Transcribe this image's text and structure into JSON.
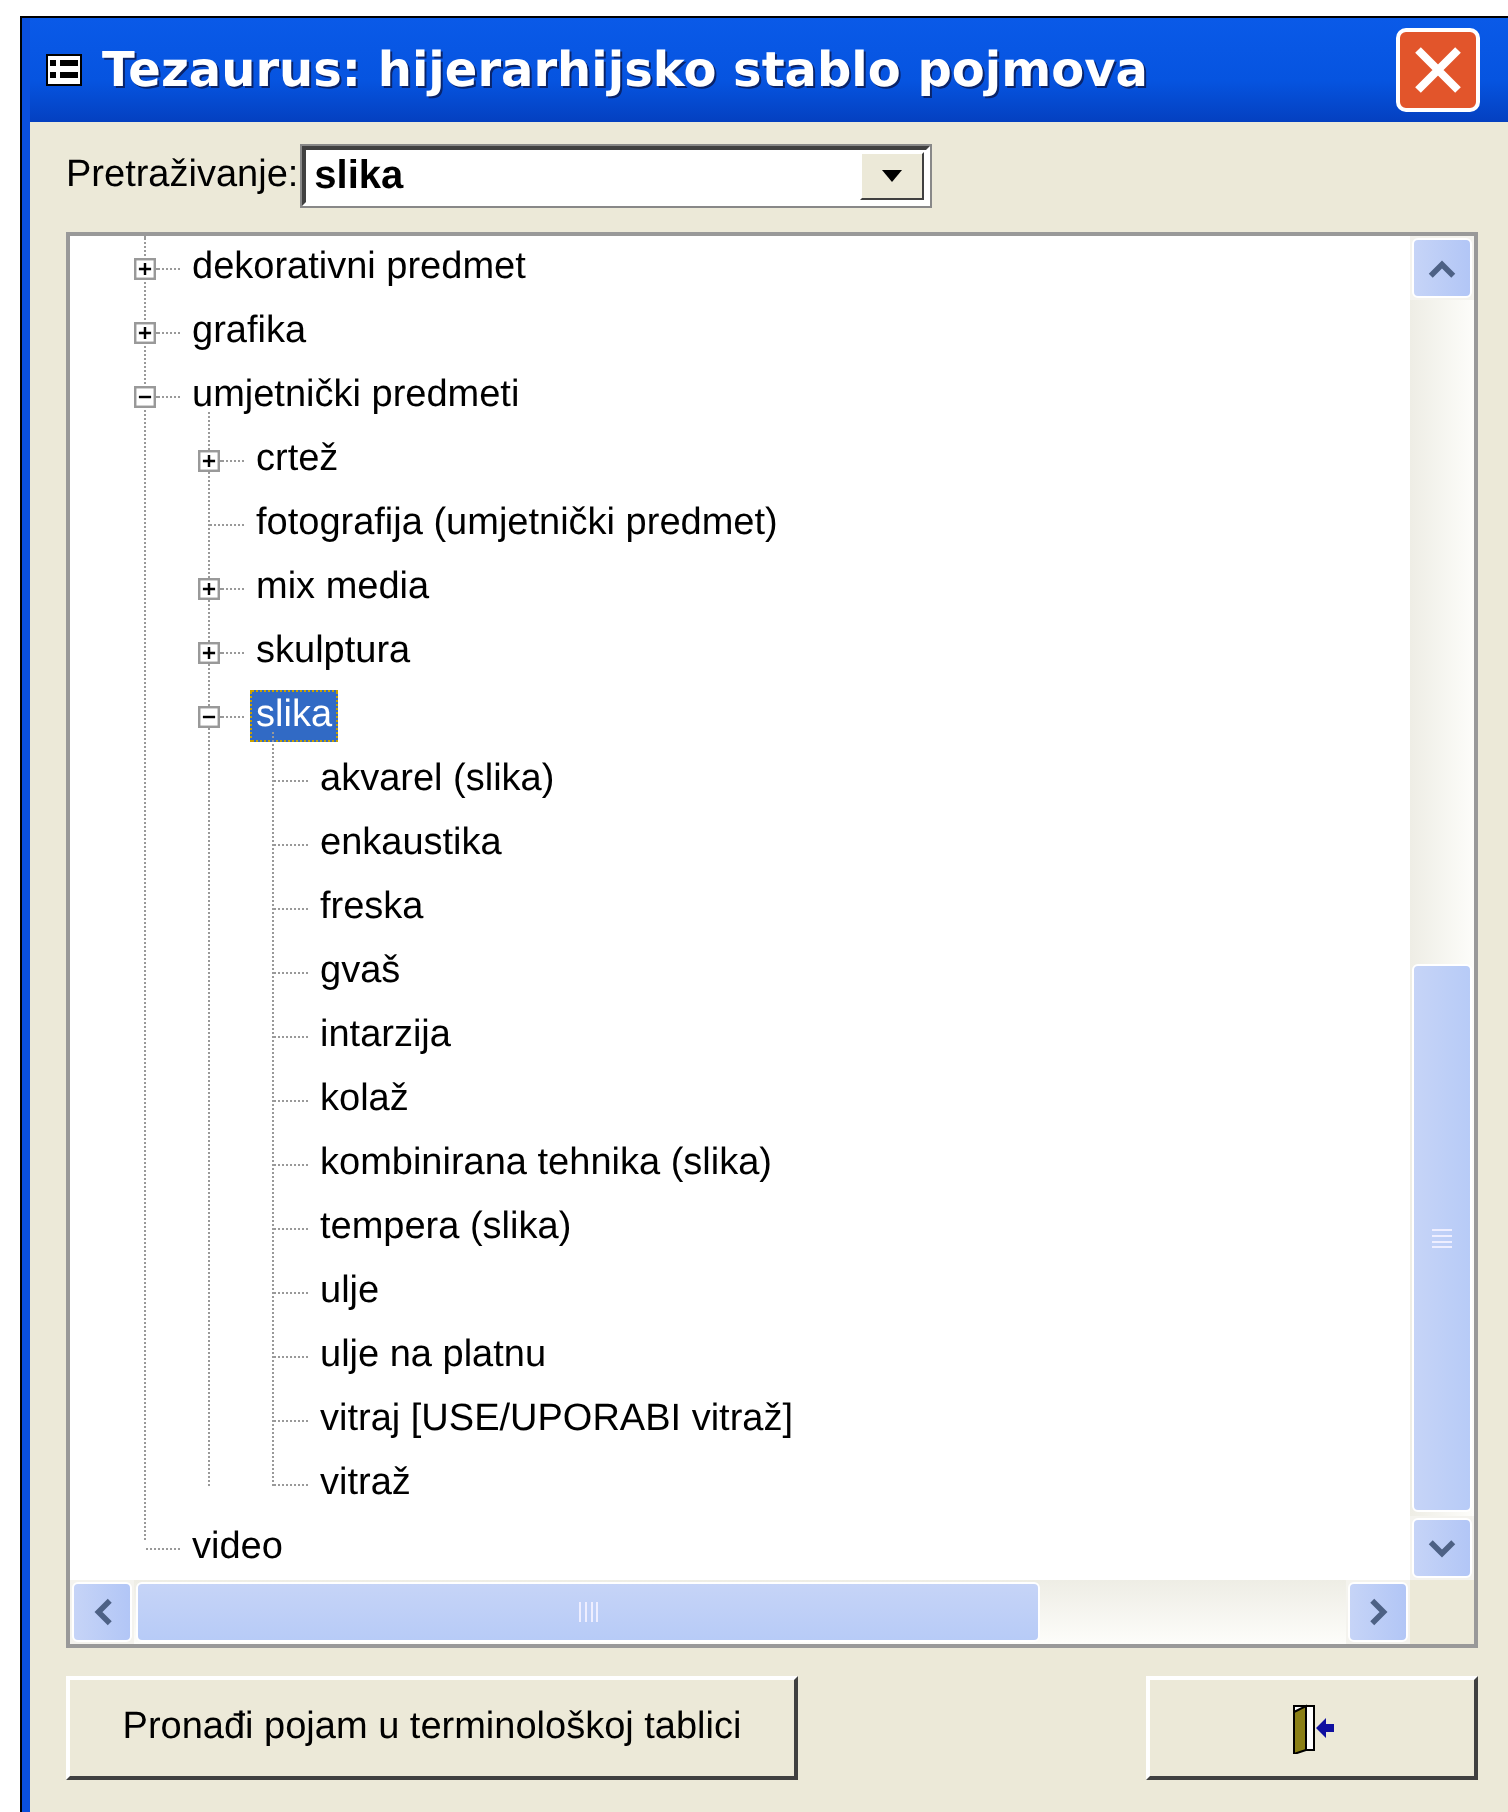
{
  "window": {
    "title": "Tezaurus: hijerarhijsko stablo pojmova"
  },
  "search": {
    "label": "Pretraživanje:",
    "value": "slika"
  },
  "tree": [
    {
      "label": "dekorativni predmet",
      "kind": "branch",
      "expanded": false,
      "selected": false
    },
    {
      "label": "grafika",
      "kind": "branch",
      "expanded": false,
      "selected": false
    },
    {
      "label": "umjetnički predmeti",
      "kind": "branch",
      "expanded": true,
      "selected": false,
      "children": [
        {
          "label": "crtež",
          "kind": "branch",
          "expanded": false,
          "selected": false
        },
        {
          "label": "fotografija (umjetnički predmet)",
          "kind": "leaf",
          "selected": false
        },
        {
          "label": "mix media",
          "kind": "branch",
          "expanded": false,
          "selected": false
        },
        {
          "label": "skulptura",
          "kind": "branch",
          "expanded": false,
          "selected": false
        },
        {
          "label": "slika",
          "kind": "branch",
          "expanded": true,
          "selected": true,
          "children": [
            {
              "label": "akvarel (slika)",
              "kind": "leaf",
              "selected": false
            },
            {
              "label": "enkaustika",
              "kind": "leaf",
              "selected": false
            },
            {
              "label": "freska",
              "kind": "leaf",
              "selected": false
            },
            {
              "label": "gvaš",
              "kind": "leaf",
              "selected": false
            },
            {
              "label": "intarzija",
              "kind": "leaf",
              "selected": false
            },
            {
              "label": "kolaž",
              "kind": "leaf",
              "selected": false
            },
            {
              "label": "kombinirana tehnika (slika)",
              "kind": "leaf",
              "selected": false
            },
            {
              "label": "tempera (slika)",
              "kind": "leaf",
              "selected": false
            },
            {
              "label": "ulje",
              "kind": "leaf",
              "selected": false
            },
            {
              "label": "ulje na platnu",
              "kind": "leaf",
              "selected": false
            },
            {
              "label": "vitraj [USE/UPORABI vitraž]",
              "kind": "leaf",
              "selected": false
            },
            {
              "label": "vitraž",
              "kind": "leaf",
              "selected": false
            }
          ]
        }
      ]
    },
    {
      "label": "video",
      "kind": "leaf",
      "selected": false
    }
  ],
  "buttons": [
    {
      "label": "Pronađi pojam u terminološkoj tablici",
      "kind": "text"
    },
    {
      "kind": "exit"
    }
  ]
}
